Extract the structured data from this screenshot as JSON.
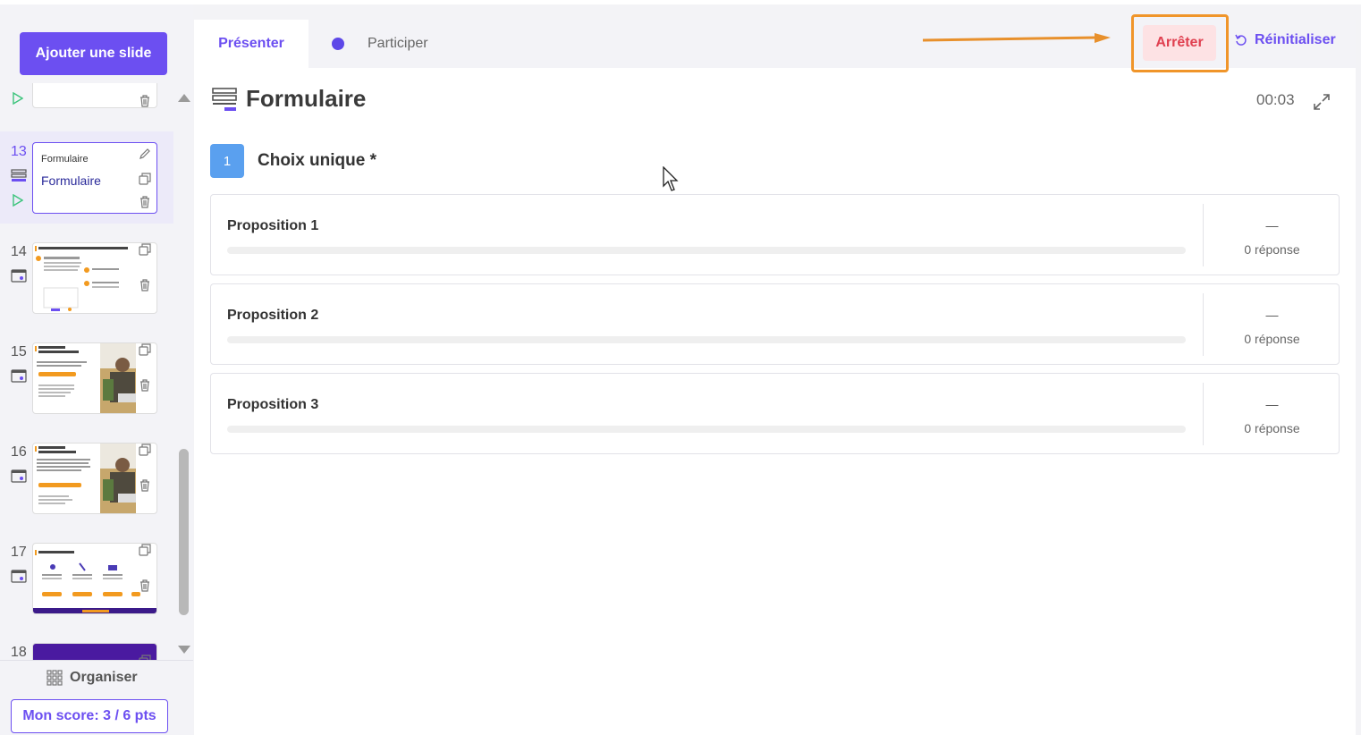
{
  "sidebar": {
    "add_slide_label": "Ajouter une slide",
    "slides": [
      {
        "number": "",
        "title_small": "",
        "title_big": ""
      },
      {
        "number": "13",
        "title_small": "Formulaire",
        "title_big": "Formulaire"
      },
      {
        "number": "14"
      },
      {
        "number": "15"
      },
      {
        "number": "16"
      },
      {
        "number": "17"
      },
      {
        "number": "18"
      }
    ],
    "organiser_label": "Organiser",
    "score_label": "Mon score: 3 / 6 pts"
  },
  "header": {
    "tab_present": "Présenter",
    "tab_participate": "Participer",
    "stop_label": "Arrêter",
    "reset_label": "Réinitialiser"
  },
  "form": {
    "title": "Formulaire",
    "timer": "00:03",
    "question": {
      "number": "1",
      "label": "Choix unique *",
      "options": [
        {
          "label": "Proposition 1",
          "dash": "—",
          "count": "0 réponse",
          "fraction": 0
        },
        {
          "label": "Proposition 2",
          "dash": "—",
          "count": "0 réponse",
          "fraction": 0
        },
        {
          "label": "Proposition 3",
          "dash": "—",
          "count": "0 réponse",
          "fraction": 0
        }
      ]
    }
  },
  "colors": {
    "accent": "#6c4ff1",
    "stop_bg": "#fde2e4",
    "stop_text": "#e04050",
    "highlight_frame": "#f0952a",
    "question_badge": "#5aa0ef"
  }
}
